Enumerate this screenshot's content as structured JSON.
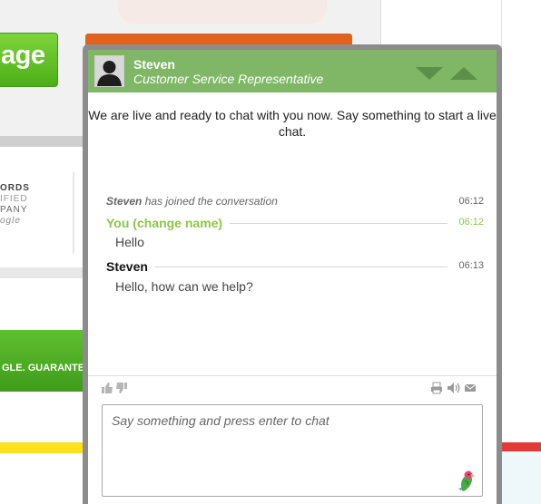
{
  "background": {
    "left_button_label": "age",
    "adwords_lines": [
      "ORDS",
      "IFIED",
      "PANY",
      "ogle"
    ],
    "guarantee_label": "GLE. GUARANTE"
  },
  "chat": {
    "agent_name": "Steven",
    "agent_title": "Customer Service Representative",
    "welcome_text": "We are live and ready to chat with you now. Say something to start a live chat.",
    "system_event": {
      "name": "Steven",
      "text": "has joined the conversation",
      "time": "06:12"
    },
    "messages": [
      {
        "sender": "You (change name)",
        "time": "06:12",
        "text": "Hello"
      },
      {
        "sender": "Steven",
        "time": "06:13",
        "text": "Hello, how can we help?"
      }
    ],
    "input_placeholder": "Say something and press enter to chat",
    "colors": {
      "header": "#7fb766",
      "frame": "#8c8c8c",
      "visitor_name": "#8dc64a"
    },
    "icons": [
      "thumbs-up-icon",
      "thumbs-down-icon",
      "print-icon",
      "sound-icon",
      "email-icon",
      "minimize-icon",
      "maximize-icon",
      "parrot-logo-icon"
    ]
  }
}
